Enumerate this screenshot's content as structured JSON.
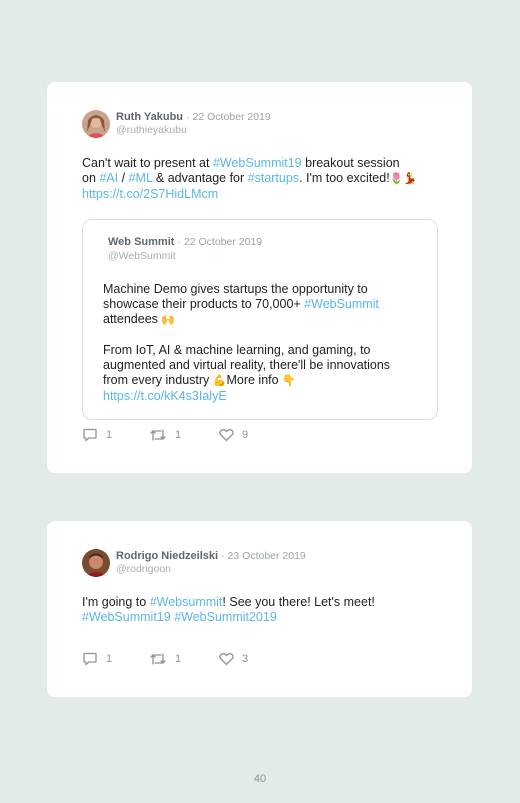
{
  "tweets": [
    {
      "author": "Ruth Yakubu",
      "date": "· 22 October 2019",
      "handle": "@ruthieyakubu",
      "text": {
        "l1a": "Can't wait to present at ",
        "l1b": "#WebSummit19",
        "l1c": " breakout session",
        "l2a": "on ",
        "l2b": "#AI",
        "l2c": " / ",
        "l2d": "#ML",
        "l2e": " & advantage for ",
        "l2f": "#startups",
        "l2g": ". I'm too excited!",
        "l2h": "🌷💃",
        "l3": "https://t.co/2S7HidLMcm"
      },
      "quote": {
        "author": "Web Summit",
        "date": "· 22 October 2019",
        "handle": "@WebSummit",
        "p1l1": "Machine Demo gives startups the opportunity to",
        "p1l2a": "showcase their products to 70,000+ ",
        "p1l2b": "#WebSummit",
        "p1l3a": "attendees ",
        "p1l3b": "🙌",
        "p2l1": "From IoT, AI & machine learning, and gaming, to",
        "p2l2": "augmented and virtual reality, there'll be innovations",
        "p2l3a": "from every industry ",
        "p2l3b": "💪",
        "p2l3c": "More info ",
        "p2l3d": "👇",
        "p2l4": "https://t.co/kK4s3IalyE"
      },
      "replies": "1",
      "retweets": "1",
      "likes": "9"
    },
    {
      "author": "Rodrigo Niedzeilski",
      "date": "· 23 October 2019",
      "handle": "@rodrigoon",
      "text": {
        "l1a": "I'm going to ",
        "l1b": "#Websummit",
        "l1c": "! See you there! Let's meet!",
        "l2a": "#WebSummit19",
        "l2b": " ",
        "l2c": "#WebSummit2019"
      },
      "replies": "1",
      "retweets": "1",
      "likes": "3"
    }
  ],
  "page_number": "40",
  "colors": {
    "background": "#e2ebe7",
    "link": "#5ab7e6",
    "card": "#ffffff"
  },
  "icons": [
    "reply-icon",
    "retweet-icon",
    "heart-icon"
  ]
}
